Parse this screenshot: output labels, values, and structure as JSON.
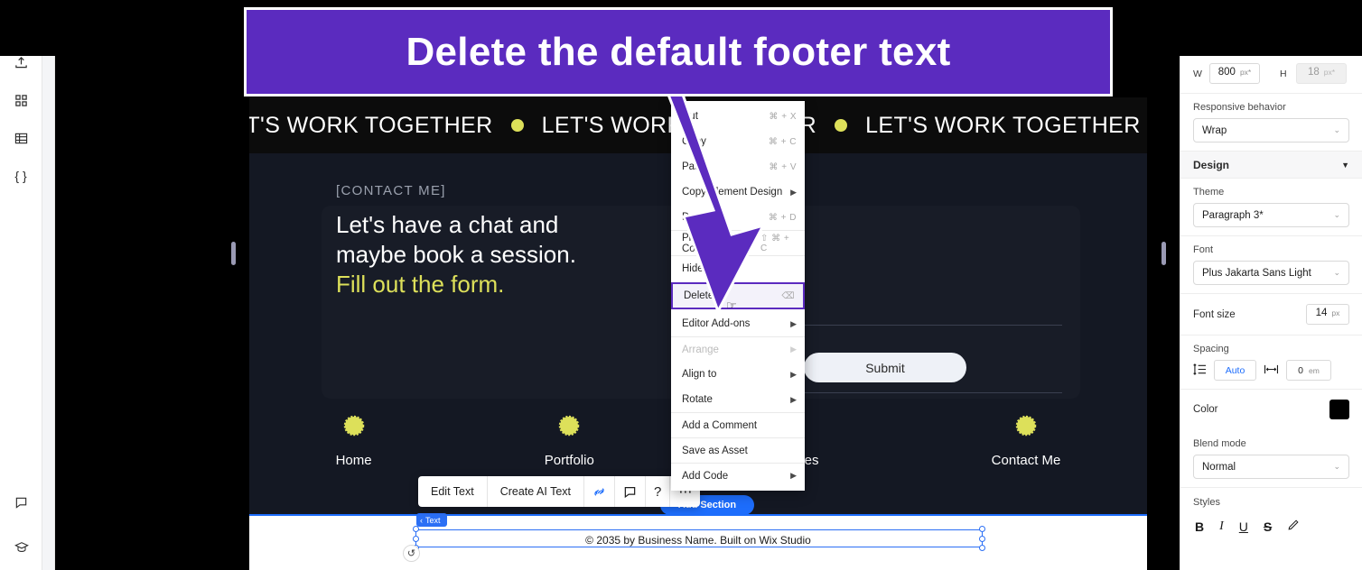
{
  "banner": {
    "text": "Delete the default footer text",
    "bg": "#5b2bbf",
    "border": "#ffffff"
  },
  "left_rail": {
    "items": [
      {
        "name": "upload-icon",
        "label": "Upload"
      },
      {
        "name": "apps-icon",
        "label": "Apps"
      },
      {
        "name": "cms-table-icon",
        "label": "CMS"
      },
      {
        "name": "dev-mode-icon",
        "label": "{ }"
      }
    ],
    "bottom_items": [
      {
        "name": "comment-icon",
        "label": "Comments"
      },
      {
        "name": "learn-icon",
        "label": "Learn"
      }
    ]
  },
  "site": {
    "marquee_text": "LET'S WORK TOGETHER",
    "marquee_dot_color": "#dde05a",
    "eyebrow": "[CONTACT ME]",
    "headline_line1": "Let's have a chat and",
    "headline_line2": "maybe book a session.",
    "headline_accent": "Fill out the form.",
    "accent_color": "#dde05a",
    "submit_label": "Submit",
    "nav": [
      {
        "label": "Home"
      },
      {
        "label": "Portfolio"
      },
      {
        "label": "Services"
      },
      {
        "label": "Contact Me"
      }
    ],
    "footer_text": "© 2035 by Business Name. Built on Wix Studio",
    "selection_badge": "Text",
    "add_section_label": "Add Section"
  },
  "text_toolbar": {
    "edit_text": "Edit Text",
    "create_ai_text": "Create AI Text",
    "link_icon": "link-icon",
    "comment_icon": "comment-icon",
    "help_icon": "?",
    "more_icon": "⋯"
  },
  "context_menu": {
    "items": [
      {
        "label": "Cut",
        "shortcut": "⌘ + X",
        "arrow": false,
        "disabled": false,
        "selected": false,
        "sep": false
      },
      {
        "label": "Copy",
        "shortcut": "⌘ + C",
        "arrow": false,
        "disabled": false,
        "selected": false,
        "sep": false
      },
      {
        "label": "Paste",
        "shortcut": "⌘ + V",
        "arrow": false,
        "disabled": false,
        "selected": false,
        "sep": false
      },
      {
        "label": "Copy Element Design",
        "shortcut": "",
        "arrow": true,
        "disabled": false,
        "selected": false,
        "sep": false
      },
      {
        "label": "Duplicate",
        "shortcut": "⌘ + D",
        "arrow": false,
        "disabled": false,
        "selected": false,
        "sep": false
      },
      {
        "label": "Place in Container",
        "shortcut": "⇧ ⌘ + C",
        "arrow": false,
        "disabled": false,
        "selected": false,
        "sep": true
      },
      {
        "label": "Hide",
        "shortcut": "",
        "arrow": false,
        "disabled": false,
        "selected": false,
        "sep": true
      },
      {
        "label": "Delete",
        "shortcut": "⌫",
        "arrow": false,
        "disabled": false,
        "selected": true,
        "sep": false
      },
      {
        "label": "Editor Add-ons",
        "shortcut": "",
        "arrow": true,
        "disabled": false,
        "selected": false,
        "sep": false
      },
      {
        "label": "Arrange",
        "shortcut": "",
        "arrow": true,
        "disabled": true,
        "selected": false,
        "sep": true
      },
      {
        "label": "Align to",
        "shortcut": "",
        "arrow": true,
        "disabled": false,
        "selected": false,
        "sep": false
      },
      {
        "label": "Rotate",
        "shortcut": "",
        "arrow": true,
        "disabled": false,
        "selected": false,
        "sep": false
      },
      {
        "label": "Add a Comment",
        "shortcut": "",
        "arrow": false,
        "disabled": false,
        "selected": false,
        "sep": true
      },
      {
        "label": "Save as Asset",
        "shortcut": "",
        "arrow": false,
        "disabled": false,
        "selected": false,
        "sep": true
      },
      {
        "label": "Add Code",
        "shortcut": "",
        "arrow": true,
        "disabled": false,
        "selected": false,
        "sep": true
      }
    ],
    "highlight_color": "#5b2bbf"
  },
  "right_panel": {
    "width_key": "W",
    "width_value": "800",
    "width_unit": "px*",
    "height_key": "H",
    "height_value": "18",
    "height_unit": "px*",
    "responsive_label": "Responsive behavior",
    "responsive_value": "Wrap",
    "design_header": "Design",
    "theme_label": "Theme",
    "theme_value": "Paragraph 3*",
    "font_label": "Font",
    "font_value": "Plus Jakarta Sans Light",
    "font_size_label": "Font size",
    "font_size_value": "14",
    "font_size_unit": "px",
    "spacing_label": "Spacing",
    "line_spacing_value": "Auto",
    "letter_spacing_value": "0",
    "letter_spacing_unit": "em",
    "color_label": "Color",
    "color_value": "#000000",
    "blend_label": "Blend mode",
    "blend_value": "Normal",
    "styles_label": "Styles",
    "styles": [
      "B",
      "I",
      "U",
      "S"
    ]
  }
}
